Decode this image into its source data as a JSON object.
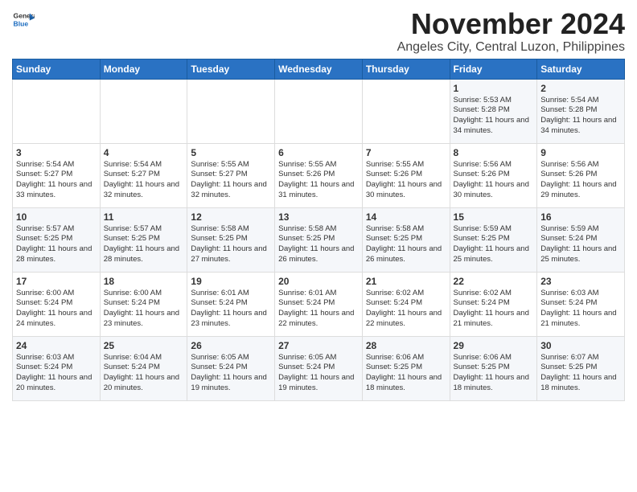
{
  "header": {
    "logo_general": "General",
    "logo_blue": "Blue",
    "title": "November 2024",
    "subtitle": "Angeles City, Central Luzon, Philippines"
  },
  "days_of_week": [
    "Sunday",
    "Monday",
    "Tuesday",
    "Wednesday",
    "Thursday",
    "Friday",
    "Saturday"
  ],
  "weeks": [
    [
      {
        "day": "",
        "info": ""
      },
      {
        "day": "",
        "info": ""
      },
      {
        "day": "",
        "info": ""
      },
      {
        "day": "",
        "info": ""
      },
      {
        "day": "",
        "info": ""
      },
      {
        "day": "1",
        "info": "Sunrise: 5:53 AM\nSunset: 5:28 PM\nDaylight: 11 hours and 34 minutes."
      },
      {
        "day": "2",
        "info": "Sunrise: 5:54 AM\nSunset: 5:28 PM\nDaylight: 11 hours and 34 minutes."
      }
    ],
    [
      {
        "day": "3",
        "info": "Sunrise: 5:54 AM\nSunset: 5:27 PM\nDaylight: 11 hours and 33 minutes."
      },
      {
        "day": "4",
        "info": "Sunrise: 5:54 AM\nSunset: 5:27 PM\nDaylight: 11 hours and 32 minutes."
      },
      {
        "day": "5",
        "info": "Sunrise: 5:55 AM\nSunset: 5:27 PM\nDaylight: 11 hours and 32 minutes."
      },
      {
        "day": "6",
        "info": "Sunrise: 5:55 AM\nSunset: 5:26 PM\nDaylight: 11 hours and 31 minutes."
      },
      {
        "day": "7",
        "info": "Sunrise: 5:55 AM\nSunset: 5:26 PM\nDaylight: 11 hours and 30 minutes."
      },
      {
        "day": "8",
        "info": "Sunrise: 5:56 AM\nSunset: 5:26 PM\nDaylight: 11 hours and 30 minutes."
      },
      {
        "day": "9",
        "info": "Sunrise: 5:56 AM\nSunset: 5:26 PM\nDaylight: 11 hours and 29 minutes."
      }
    ],
    [
      {
        "day": "10",
        "info": "Sunrise: 5:57 AM\nSunset: 5:25 PM\nDaylight: 11 hours and 28 minutes."
      },
      {
        "day": "11",
        "info": "Sunrise: 5:57 AM\nSunset: 5:25 PM\nDaylight: 11 hours and 28 minutes."
      },
      {
        "day": "12",
        "info": "Sunrise: 5:58 AM\nSunset: 5:25 PM\nDaylight: 11 hours and 27 minutes."
      },
      {
        "day": "13",
        "info": "Sunrise: 5:58 AM\nSunset: 5:25 PM\nDaylight: 11 hours and 26 minutes."
      },
      {
        "day": "14",
        "info": "Sunrise: 5:58 AM\nSunset: 5:25 PM\nDaylight: 11 hours and 26 minutes."
      },
      {
        "day": "15",
        "info": "Sunrise: 5:59 AM\nSunset: 5:25 PM\nDaylight: 11 hours and 25 minutes."
      },
      {
        "day": "16",
        "info": "Sunrise: 5:59 AM\nSunset: 5:24 PM\nDaylight: 11 hours and 25 minutes."
      }
    ],
    [
      {
        "day": "17",
        "info": "Sunrise: 6:00 AM\nSunset: 5:24 PM\nDaylight: 11 hours and 24 minutes."
      },
      {
        "day": "18",
        "info": "Sunrise: 6:00 AM\nSunset: 5:24 PM\nDaylight: 11 hours and 23 minutes."
      },
      {
        "day": "19",
        "info": "Sunrise: 6:01 AM\nSunset: 5:24 PM\nDaylight: 11 hours and 23 minutes."
      },
      {
        "day": "20",
        "info": "Sunrise: 6:01 AM\nSunset: 5:24 PM\nDaylight: 11 hours and 22 minutes."
      },
      {
        "day": "21",
        "info": "Sunrise: 6:02 AM\nSunset: 5:24 PM\nDaylight: 11 hours and 22 minutes."
      },
      {
        "day": "22",
        "info": "Sunrise: 6:02 AM\nSunset: 5:24 PM\nDaylight: 11 hours and 21 minutes."
      },
      {
        "day": "23",
        "info": "Sunrise: 6:03 AM\nSunset: 5:24 PM\nDaylight: 11 hours and 21 minutes."
      }
    ],
    [
      {
        "day": "24",
        "info": "Sunrise: 6:03 AM\nSunset: 5:24 PM\nDaylight: 11 hours and 20 minutes."
      },
      {
        "day": "25",
        "info": "Sunrise: 6:04 AM\nSunset: 5:24 PM\nDaylight: 11 hours and 20 minutes."
      },
      {
        "day": "26",
        "info": "Sunrise: 6:05 AM\nSunset: 5:24 PM\nDaylight: 11 hours and 19 minutes."
      },
      {
        "day": "27",
        "info": "Sunrise: 6:05 AM\nSunset: 5:24 PM\nDaylight: 11 hours and 19 minutes."
      },
      {
        "day": "28",
        "info": "Sunrise: 6:06 AM\nSunset: 5:25 PM\nDaylight: 11 hours and 18 minutes."
      },
      {
        "day": "29",
        "info": "Sunrise: 6:06 AM\nSunset: 5:25 PM\nDaylight: 11 hours and 18 minutes."
      },
      {
        "day": "30",
        "info": "Sunrise: 6:07 AM\nSunset: 5:25 PM\nDaylight: 11 hours and 18 minutes."
      }
    ]
  ]
}
